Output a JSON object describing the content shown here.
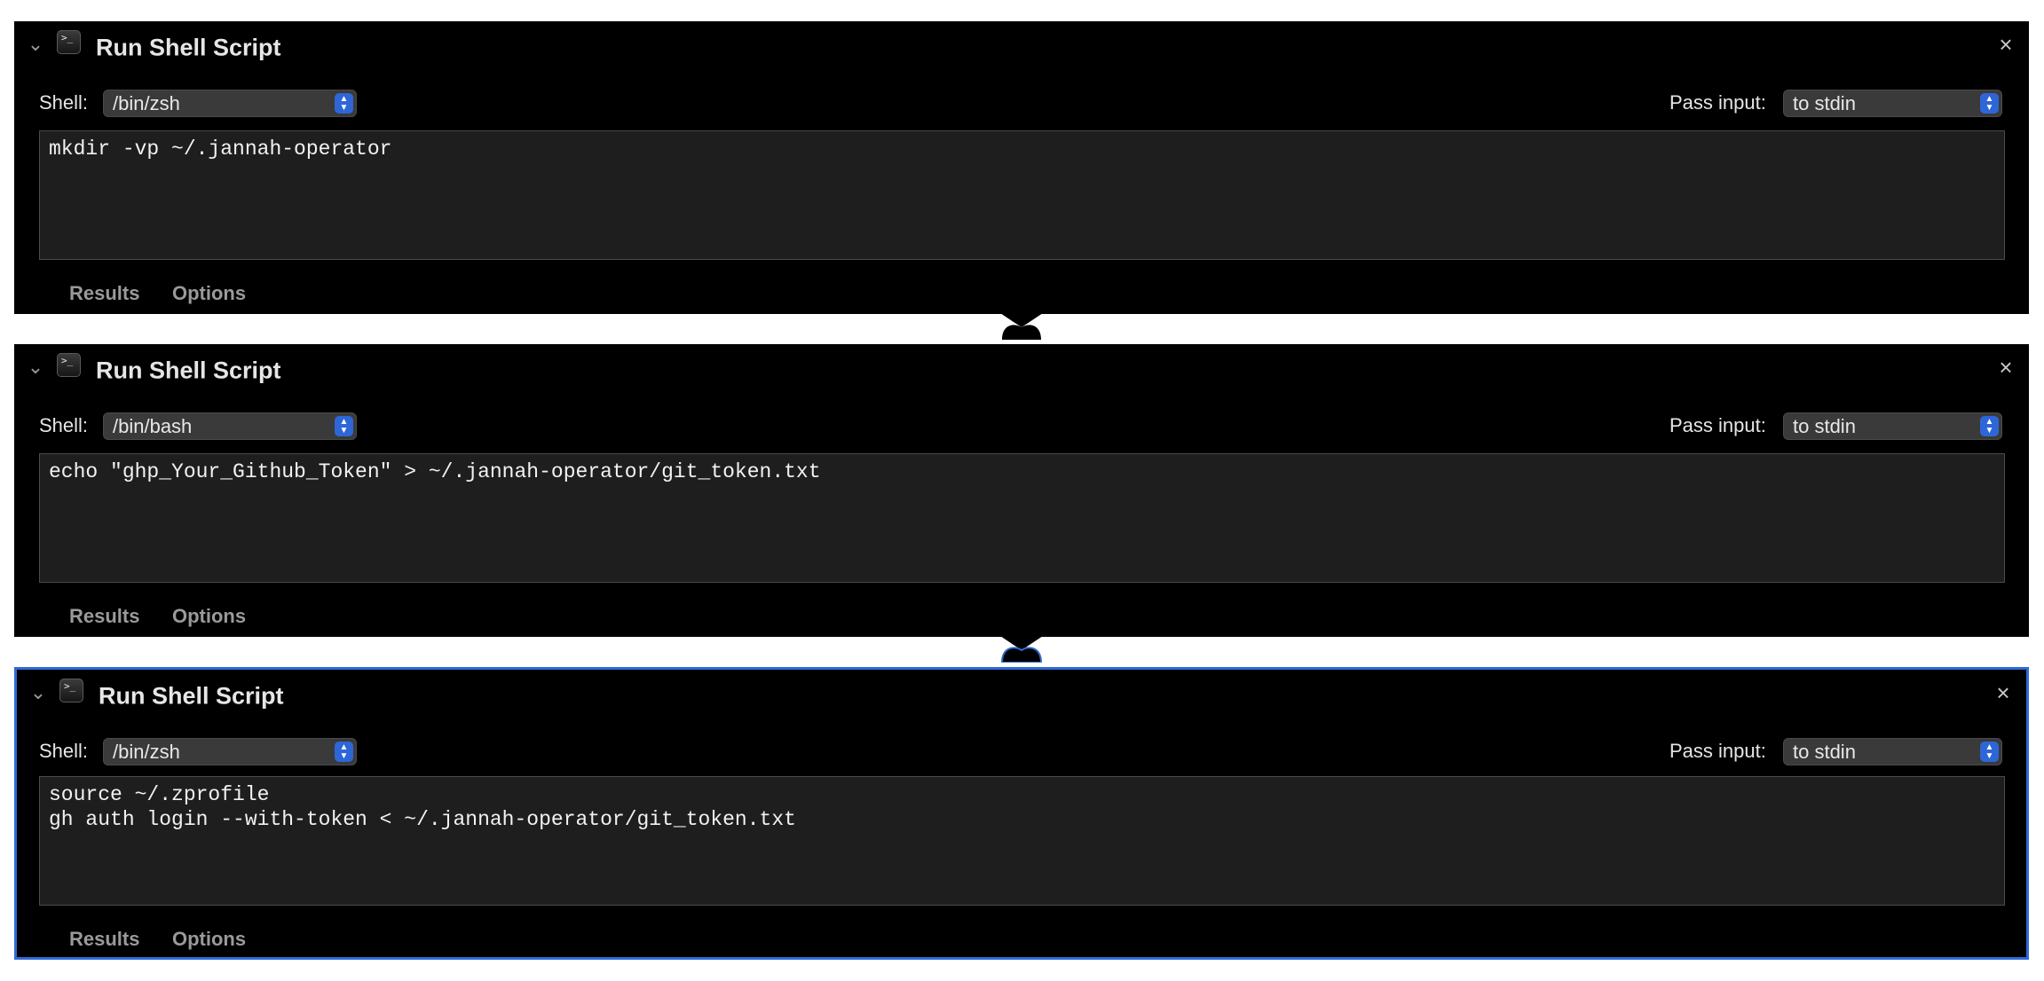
{
  "actions": [
    {
      "title": "Run Shell Script",
      "shell_label": "Shell:",
      "shell_value": "/bin/zsh",
      "pass_input_label": "Pass input:",
      "pass_input_value": "to stdin",
      "script_lines": [
        "mkdir -vp ~/.jannah-operator"
      ],
      "tabs": [
        "Results",
        "Options"
      ],
      "selected": false
    },
    {
      "title": "Run Shell Script",
      "shell_label": "Shell:",
      "shell_value": "/bin/bash",
      "pass_input_label": "Pass input:",
      "pass_input_value": "to stdin",
      "script_lines": [
        "echo \"ghp_Your_Github_Token\" > ~/.jannah-operator/git_token.txt"
      ],
      "tabs": [
        "Results",
        "Options"
      ],
      "selected": false
    },
    {
      "title": "Run Shell Script",
      "shell_label": "Shell:",
      "shell_value": "/bin/zsh",
      "pass_input_label": "Pass input:",
      "pass_input_value": "to stdin",
      "script_lines": [
        "source ~/.zprofile",
        "gh auth login --with-token < ~/.jannah-operator/git_token.txt"
      ],
      "tabs": [
        "Results",
        "Options"
      ],
      "selected": true
    }
  ],
  "icons": {
    "disclosure": "chevron-down-icon",
    "app": "terminal-icon",
    "close": "close-icon",
    "stepper": "updown-chevron-icon"
  },
  "colors": {
    "panel_background": "#000000",
    "editor_background": "#1e1e1e",
    "selection_border": "#2f6bd6",
    "select_accent": "#2e66d8",
    "tab_text": "#9a9a9a"
  }
}
